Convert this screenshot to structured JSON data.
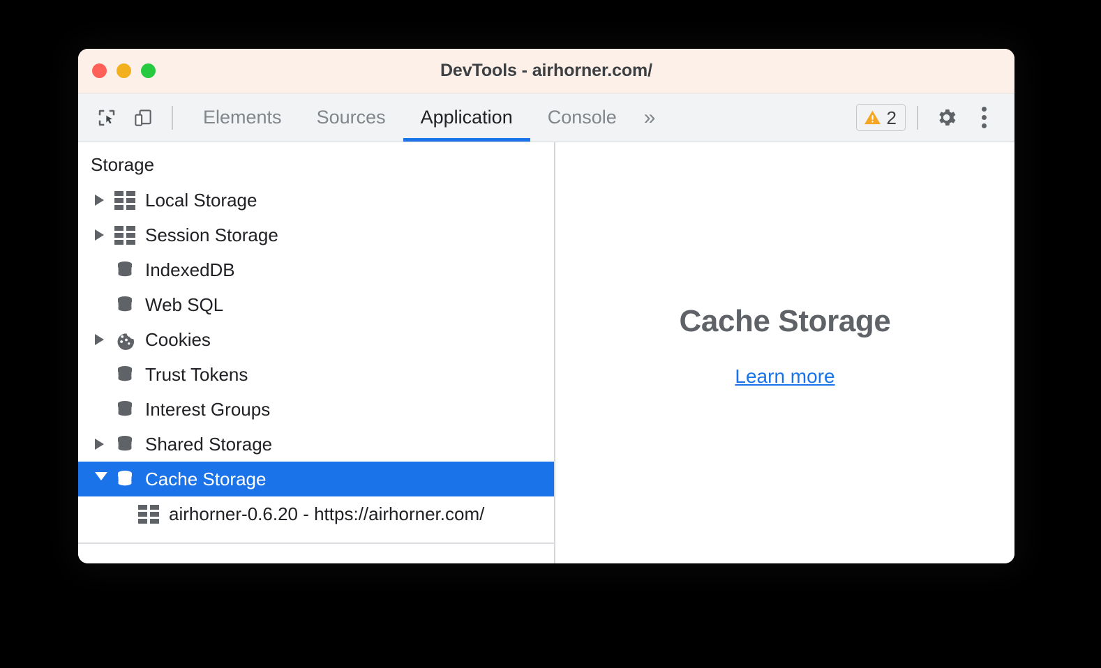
{
  "window": {
    "title": "DevTools - airhorner.com/",
    "traffic_lights": [
      {
        "name": "close",
        "color": "#ff6057"
      },
      {
        "name": "minimize",
        "color": "#f2b01e"
      },
      {
        "name": "zoom",
        "color": "#27c93f"
      }
    ]
  },
  "toolbar": {
    "inspect_icon": "inspect-element-icon",
    "device_icon": "device-toolbar-icon",
    "tabs": [
      {
        "label": "Elements",
        "active": false
      },
      {
        "label": "Sources",
        "active": false
      },
      {
        "label": "Application",
        "active": true
      },
      {
        "label": "Console",
        "active": false
      }
    ],
    "more_tabs": "»",
    "warning_badge": {
      "icon": "warning-triangle-icon",
      "count": "2",
      "color": "#f5a623"
    },
    "settings_icon": "gear-icon",
    "menu_icon": "kebab-menu-icon",
    "active_tab_underline_color": "#1a73e8"
  },
  "sidebar": {
    "header": "Storage",
    "items": [
      {
        "label": "Local Storage",
        "icon": "grid-icon",
        "expandable": true,
        "expanded": false,
        "selected": false,
        "child": false
      },
      {
        "label": "Session Storage",
        "icon": "grid-icon",
        "expandable": true,
        "expanded": false,
        "selected": false,
        "child": false
      },
      {
        "label": "IndexedDB",
        "icon": "database-icon",
        "expandable": false,
        "expanded": false,
        "selected": false,
        "child": false
      },
      {
        "label": "Web SQL",
        "icon": "database-icon",
        "expandable": false,
        "expanded": false,
        "selected": false,
        "child": false
      },
      {
        "label": "Cookies",
        "icon": "cookie-icon",
        "expandable": true,
        "expanded": false,
        "selected": false,
        "child": false
      },
      {
        "label": "Trust Tokens",
        "icon": "database-icon",
        "expandable": false,
        "expanded": false,
        "selected": false,
        "child": false
      },
      {
        "label": "Interest Groups",
        "icon": "database-icon",
        "expandable": false,
        "expanded": false,
        "selected": false,
        "child": false
      },
      {
        "label": "Shared Storage",
        "icon": "database-icon",
        "expandable": true,
        "expanded": false,
        "selected": false,
        "child": false
      },
      {
        "label": "Cache Storage",
        "icon": "database-icon",
        "expandable": true,
        "expanded": true,
        "selected": true,
        "child": false
      },
      {
        "label": "airhorner-0.6.20 - https://airhorner.com/",
        "icon": "grid-icon",
        "expandable": false,
        "expanded": false,
        "selected": false,
        "child": true
      }
    ],
    "selected_background": "#1a73e8"
  },
  "main": {
    "empty_state_title": "Cache Storage",
    "learn_more_label": "Learn more",
    "link_color": "#1a73e8"
  }
}
